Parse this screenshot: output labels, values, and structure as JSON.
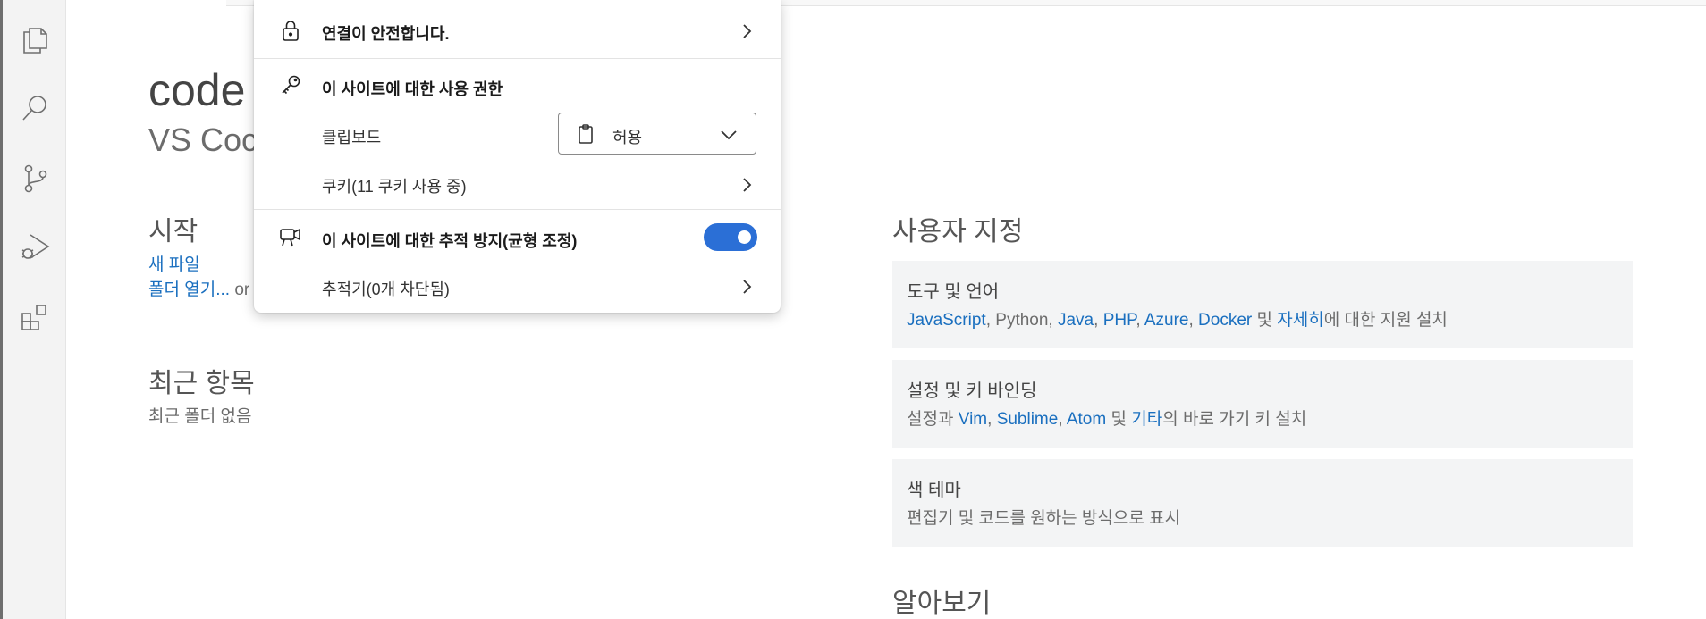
{
  "activity_bar": {
    "icons": [
      "files-icon",
      "search-icon",
      "source-control-icon",
      "run-debug-icon",
      "extensions-icon"
    ]
  },
  "welcome": {
    "title": "code",
    "subtitle": "VS Coc",
    "start": {
      "heading": "시작",
      "new_file": "새 파일",
      "open_folder": "폴더 열기...",
      "open_folder_suffix": " or"
    },
    "recent": {
      "heading": "최근 항목",
      "empty": "최근 폴더 없음"
    },
    "customize": {
      "heading": "사용자 지정",
      "tools": {
        "title": "도구 및 언어",
        "links": [
          "JavaScript",
          "Python",
          "Java",
          "PHP",
          "Azure",
          "Docker"
        ],
        "and": " 및 ",
        "more": "자세히",
        "suffix": "에 대한 지원 설치"
      },
      "keybindings": {
        "title": "설정 및 키 바인딩",
        "prefix": "설정과 ",
        "links": [
          "Vim",
          "Sublime",
          "Atom"
        ],
        "and": " 및 ",
        "more": "기타",
        "suffix": "의 바로 가기 키 설치"
      },
      "theme": {
        "title": "색 테마",
        "desc": "편집기 및 코드를 원하는 방식으로 표시"
      }
    },
    "learn": {
      "heading": "알아보기"
    }
  },
  "site_info_popup": {
    "connection": "연결이 안전합니다.",
    "permissions_heading": "이 사이트에 대한 사용 권한",
    "clipboard_label": "클립보드",
    "clipboard_value": "허용",
    "cookies": "쿠키(11 쿠키 사용 중)",
    "tracking_heading": "이 사이트에 대한 추적 방지(균형 조정)",
    "tracking_enabled": true,
    "trackers": "추적기(0개 차단됨)"
  },
  "colors": {
    "link": "#1a6fbf",
    "toggle_on": "#2b6fd6"
  }
}
